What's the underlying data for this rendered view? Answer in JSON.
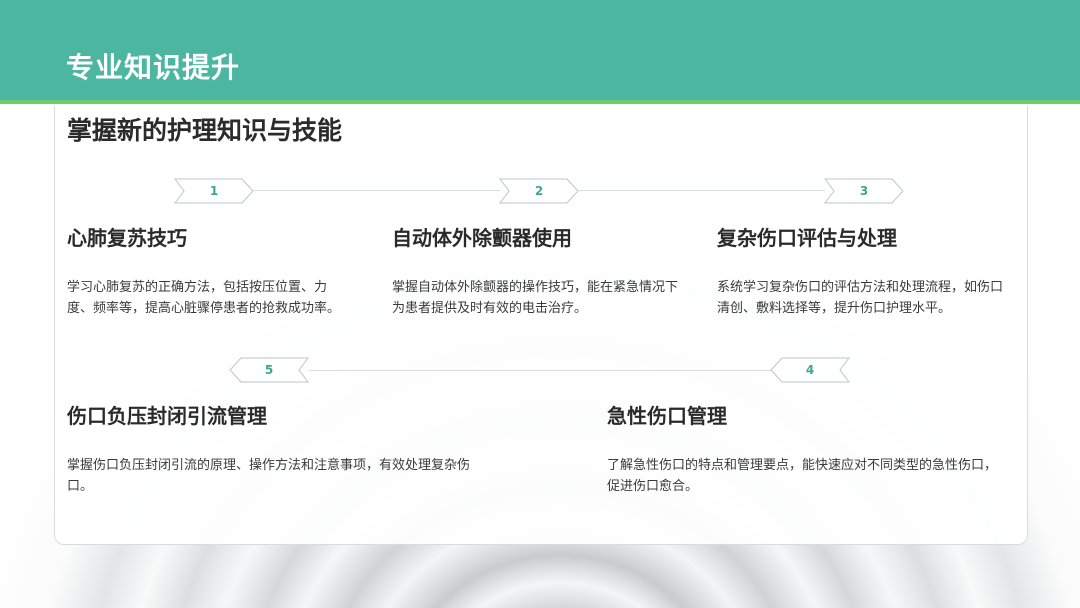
{
  "header": {
    "title": "专业知识提升",
    "bar_color": "#4db6a1",
    "line_color": "#6ccf73"
  },
  "subtitle": "掌握新的护理知识与技能",
  "items": [
    {
      "num": "1",
      "title": "心肺复苏技巧",
      "desc": "学习心肺复苏的正确方法，包括按压位置、力度、频率等，提高心脏骤停患者的抢救成功率。"
    },
    {
      "num": "2",
      "title": "自动体外除颤器使用",
      "desc": "掌握自动体外除颤器的操作技巧，能在紧急情况下为患者提供及时有效的电击治疗。"
    },
    {
      "num": "3",
      "title": "复杂伤口评估与处理",
      "desc": "系统学习复杂伤口的评估方法和处理流程，如伤口清创、敷料选择等，提升伤口护理水平。"
    },
    {
      "num": "4",
      "title": "急性伤口管理",
      "desc": "了解急性伤口的特点和管理要点，能快速应对不同类型的急性伤口，促进伤口愈合。"
    },
    {
      "num": "5",
      "title": "伤口负压封闭引流管理",
      "desc": "掌握伤口负压封闭引流的原理、操作方法和注意事项，有效处理复杂伤口。"
    }
  ]
}
